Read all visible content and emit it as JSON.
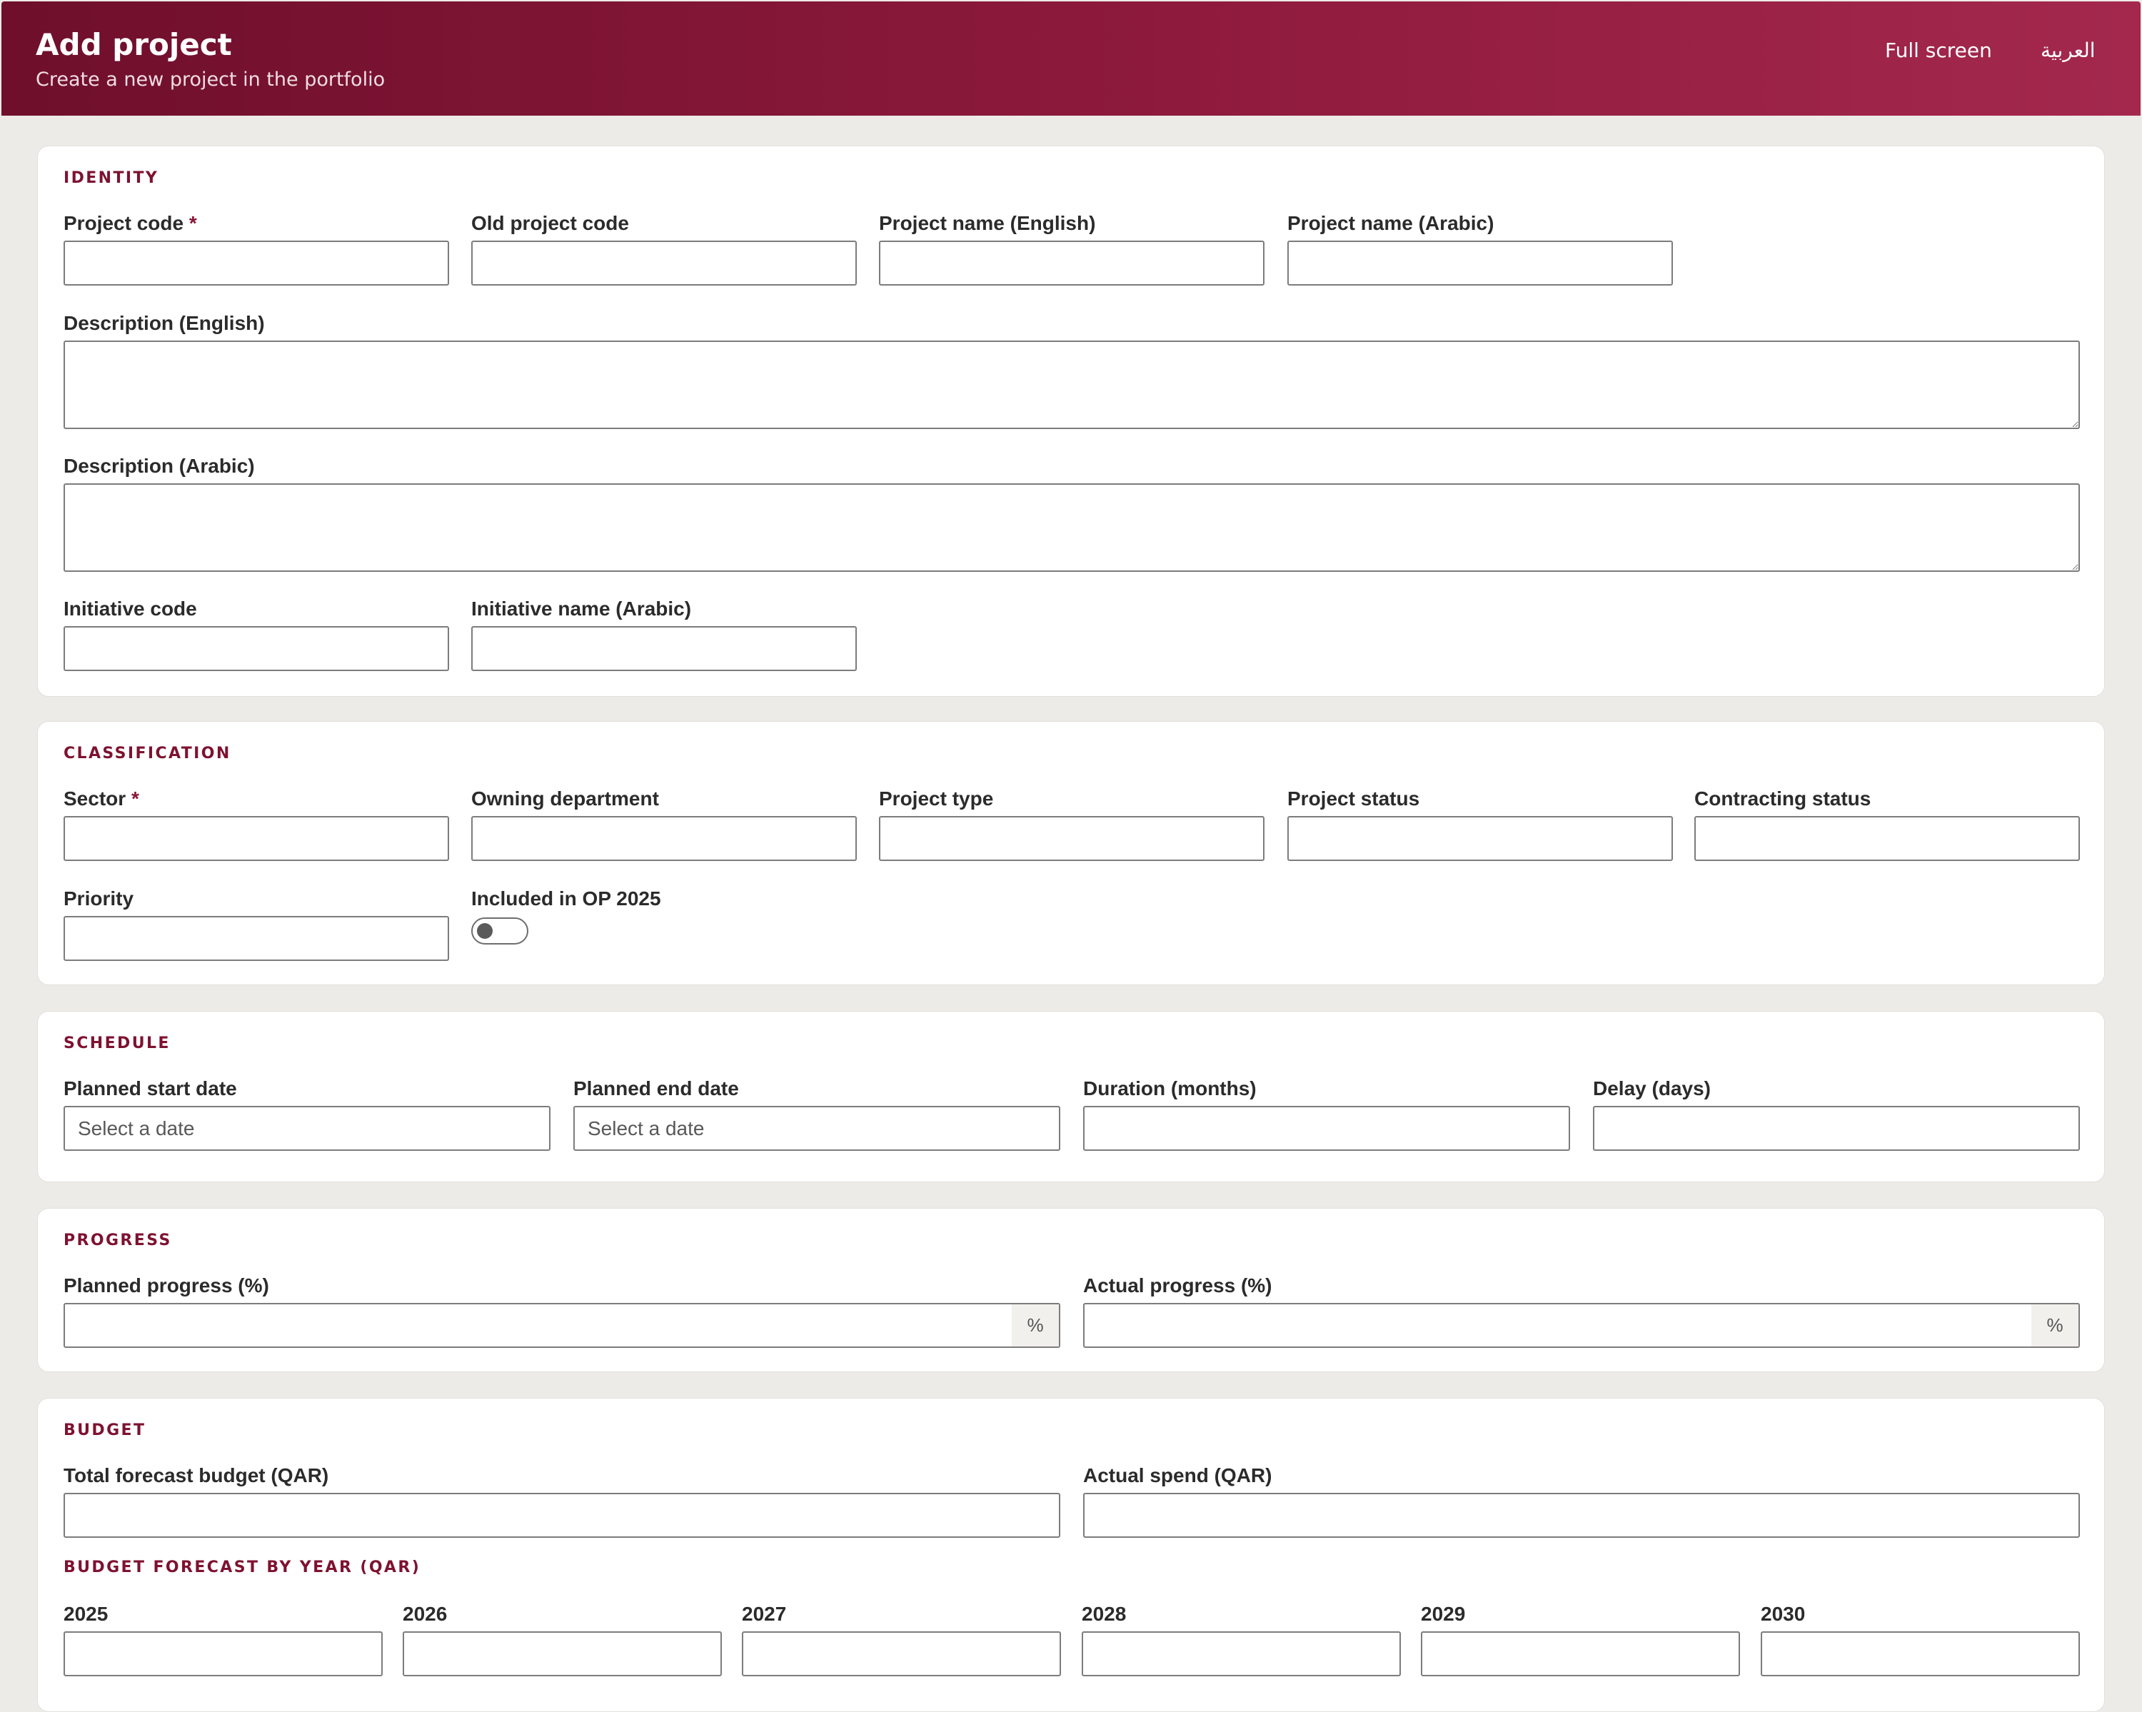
{
  "header": {
    "title": "Add project",
    "subtitle": "Create a new project in the portfolio",
    "fullscreen_label": "Full screen",
    "language_label": "العربية"
  },
  "identity": {
    "section_title": "IDENTITY",
    "project_code_label": "Project code",
    "required_marker": "*",
    "old_project_code_label": "Old project code",
    "project_name_en_label": "Project name (English)",
    "project_name_ar_label": "Project name (Arabic)",
    "description_en_label": "Description (English)",
    "description_ar_label": "Description (Arabic)",
    "initiative_code_label": "Initiative code",
    "initiative_name_ar_label": "Initiative name (Arabic)"
  },
  "classification": {
    "section_title": "CLASSIFICATION",
    "sector_label": "Sector",
    "required_marker": "*",
    "owning_department_label": "Owning department",
    "project_type_label": "Project type",
    "project_status_label": "Project status",
    "contracting_status_label": "Contracting status",
    "priority_label": "Priority",
    "included_op_label": "Included in OP 2025",
    "included_op_value": false
  },
  "schedule": {
    "section_title": "SCHEDULE",
    "planned_start_label": "Planned start date",
    "planned_start_placeholder": "Select a date",
    "planned_end_label": "Planned end date",
    "planned_end_placeholder": "Select a date",
    "duration_label": "Duration (months)",
    "delay_label": "Delay (days)"
  },
  "progress": {
    "section_title": "PROGRESS",
    "planned_label": "Planned progress (%)",
    "actual_label": "Actual progress (%)",
    "suffix": "%"
  },
  "budget": {
    "section_title": "BUDGET",
    "total_forecast_label": "Total forecast budget (QAR)",
    "actual_spend_label": "Actual spend (QAR)",
    "forecast_by_year_title": "BUDGET FORECAST BY YEAR (QAR)",
    "years": [
      "2025",
      "2026",
      "2027",
      "2028",
      "2029",
      "2030"
    ]
  },
  "colors": {
    "header_start": "#6f0f2c",
    "header_end": "#a4284e",
    "accent": "#7e1230",
    "page_background": "#edebe7"
  }
}
